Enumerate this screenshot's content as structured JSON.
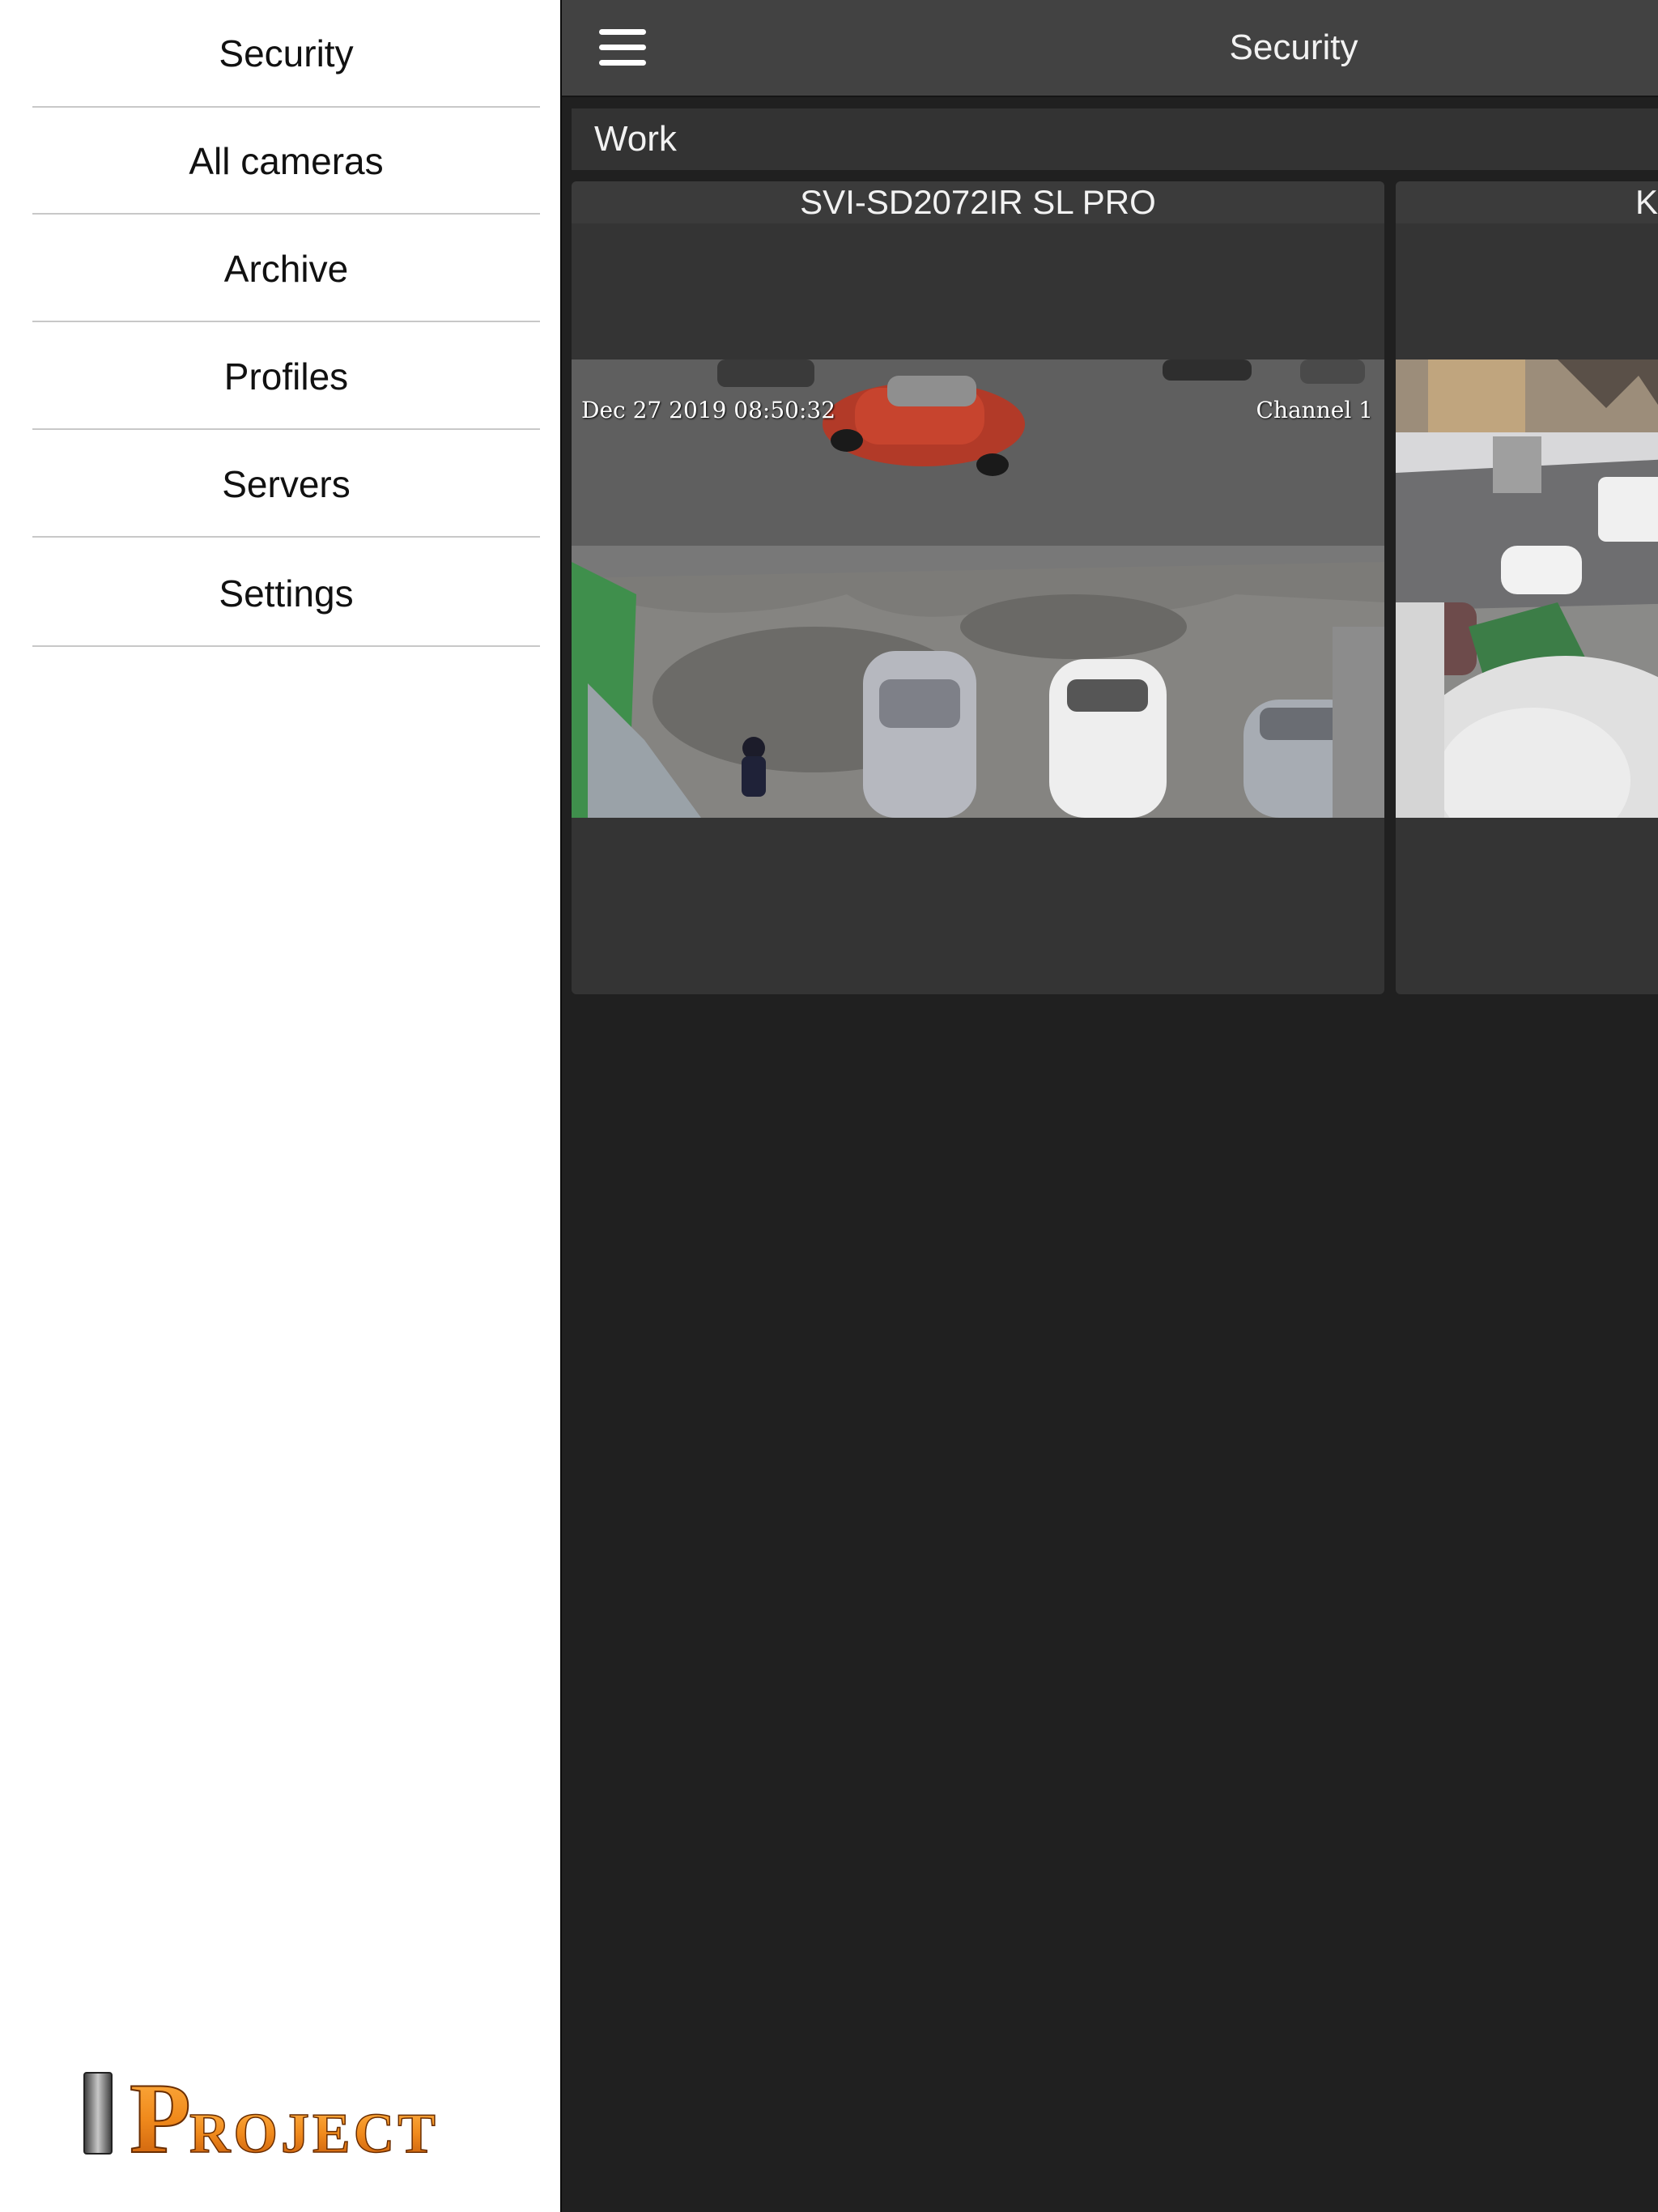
{
  "sidebar": {
    "items": [
      {
        "label": "Security"
      },
      {
        "label": "All cameras"
      },
      {
        "label": "Archive"
      },
      {
        "label": "Profiles"
      },
      {
        "label": "Servers"
      },
      {
        "label": "Settings"
      }
    ],
    "logo_text": "PROJECT"
  },
  "topbar": {
    "title": "Security",
    "menu_icon": "hamburger-menu-icon"
  },
  "group": {
    "name": "Work"
  },
  "cameras": [
    {
      "name": "SVI-SD2072IR SL PRO",
      "osd_timestamp": "Dec 27 2019 08:50:32",
      "osd_channel": "Channel 1"
    },
    {
      "name": "K"
    }
  ],
  "colors": {
    "sidebar_bg": "#ffffff",
    "main_bg": "#202020",
    "topbar_bg": "#424242",
    "tile_bg": "#343434",
    "logo_orange": "#f08a1c"
  }
}
